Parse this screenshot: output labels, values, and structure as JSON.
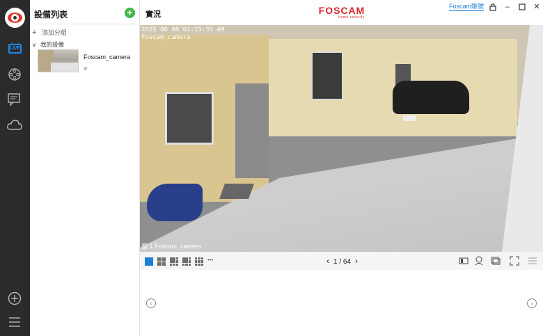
{
  "rail": {
    "icons": [
      "app-logo-icon",
      "live-icon",
      "playback-icon",
      "message-icon",
      "cloud-icon",
      "add-icon",
      "menu-icon"
    ],
    "live_label": "LIVE"
  },
  "device_panel": {
    "title": "設備列表",
    "add_group": "添加分組",
    "my_devices": "我的設備",
    "camera_name": "Foscam_camera",
    "camera_settings_glyph": "≡"
  },
  "header": {
    "title": "實況",
    "brand": "FOSCAM",
    "brand_sub": "home security",
    "account": "Foscam賬號"
  },
  "video": {
    "timestamp_line1": "2025 06 08 01:15:35 AM",
    "timestamp_line2": "Foscam_camera",
    "window_label": "窗 1 Foscam_camera"
  },
  "toolbar": {
    "more": "•••",
    "page_current": "1",
    "page_sep": "/",
    "page_total": "64",
    "prev": "‹",
    "next": "›"
  },
  "lower": {
    "prev": "‹",
    "next": "›"
  },
  "colors": {
    "accent": "#1e7fd6",
    "brand_red": "#d9252a",
    "add_green": "#43b549",
    "rail_bg": "#2b2b2b"
  }
}
